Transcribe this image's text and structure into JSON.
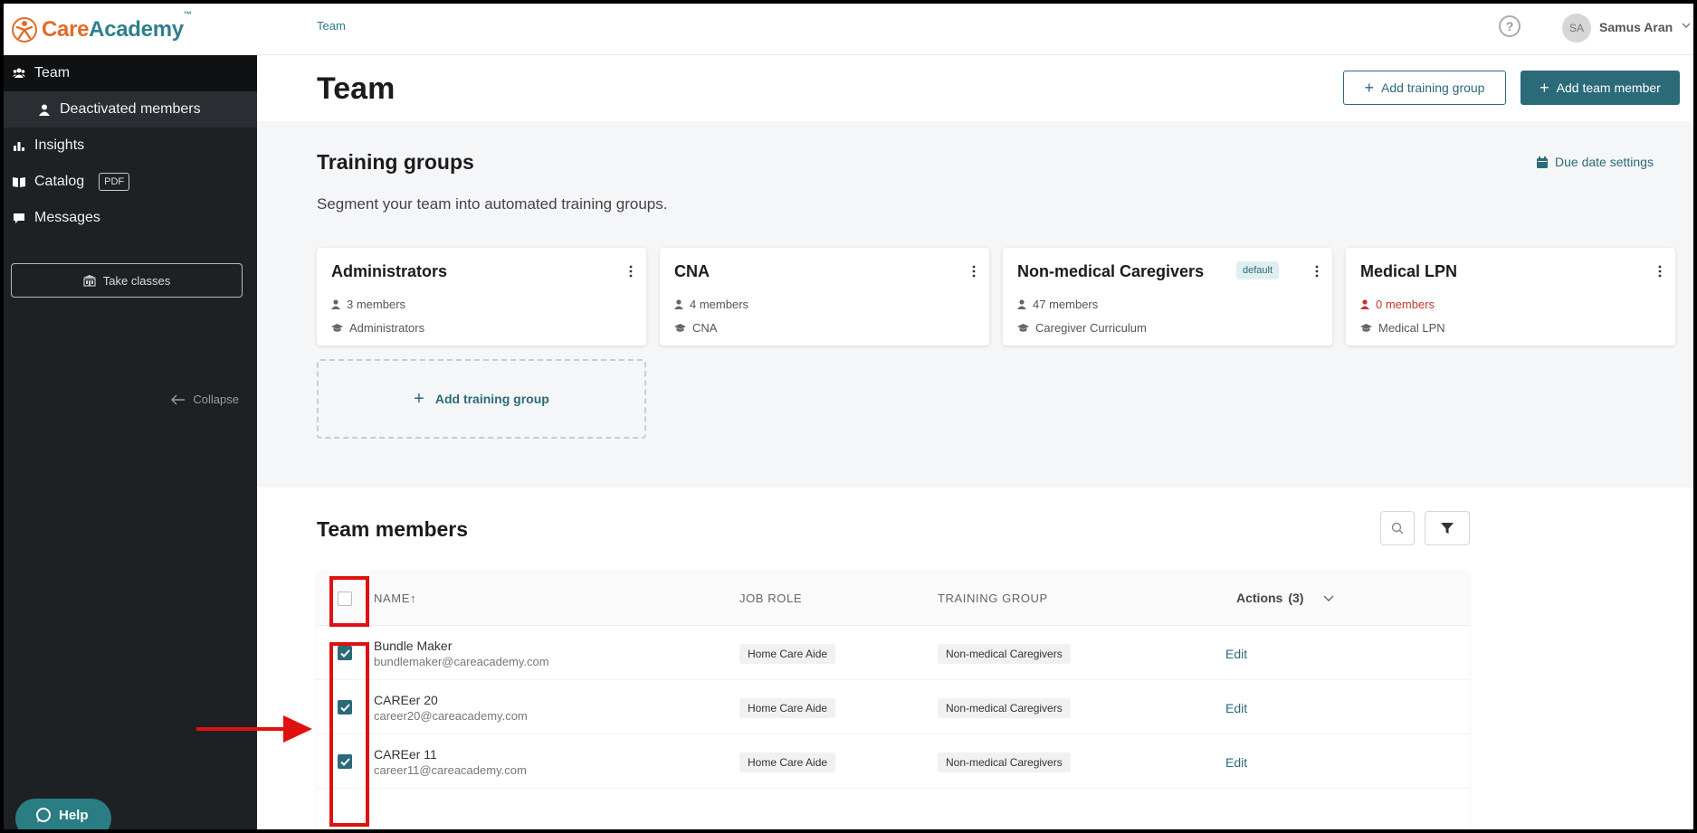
{
  "brand": {
    "care": "Care",
    "academy": "Academy",
    "tm": "™"
  },
  "sidebar": {
    "items": [
      {
        "label": "Team",
        "icon": "users-icon"
      },
      {
        "label": "Deactivated members",
        "icon": "user-icon"
      },
      {
        "label": "Insights",
        "icon": "bar-chart-icon"
      },
      {
        "label": "Catalog",
        "icon": "book-icon",
        "badge": "PDF"
      },
      {
        "label": "Messages",
        "icon": "chat-icon"
      }
    ],
    "take_classes": "Take classes",
    "collapse": "Collapse",
    "help": "Help"
  },
  "topbar": {
    "breadcrumb": "Team",
    "help_icon": "?",
    "avatar_initials": "SA",
    "user_name": "Samus Aran"
  },
  "header": {
    "title": "Team",
    "add_training_group": "Add training group",
    "add_team_member": "Add team member"
  },
  "training_groups": {
    "title": "Training groups",
    "description": "Segment your team into automated training groups.",
    "due_date_settings": "Due date settings",
    "cards": [
      {
        "name": "Administrators",
        "members": "3 members",
        "curriculum": "Administrators"
      },
      {
        "name": "CNA",
        "members": "4 members",
        "curriculum": "CNA"
      },
      {
        "name": "Non-medical Caregivers",
        "badge": "default",
        "members": "47 members",
        "curriculum": "Caregiver Curriculum"
      },
      {
        "name": "Medical LPN",
        "members": "0 members",
        "curriculum": "Medical LPN"
      }
    ],
    "add_card_label": "Add training group"
  },
  "team_members": {
    "title": "Team members",
    "columns": {
      "name": "NAME↑",
      "job_role": "JOB ROLE",
      "training_group": "TRAINING GROUP"
    },
    "actions_label": "Actions",
    "actions_count": "(3)",
    "rows": [
      {
        "name": "Bundle Maker",
        "email": "bundlemaker@careacademy.com",
        "job_role": "Home Care Aide",
        "training_group": "Non-medical Caregivers",
        "edit": "Edit"
      },
      {
        "name": "CAREer 20",
        "email": "career20@careacademy.com",
        "job_role": "Home Care Aide",
        "training_group": "Non-medical Caregivers",
        "edit": "Edit"
      },
      {
        "name": "CAREer 11",
        "email": "career11@careacademy.com",
        "job_role": "Home Care Aide",
        "training_group": "Non-medical Caregivers",
        "edit": "Edit"
      }
    ]
  },
  "colors": {
    "accent": "#2b6a78",
    "sidebar": "#1e2124",
    "annotation": "#e01010"
  }
}
